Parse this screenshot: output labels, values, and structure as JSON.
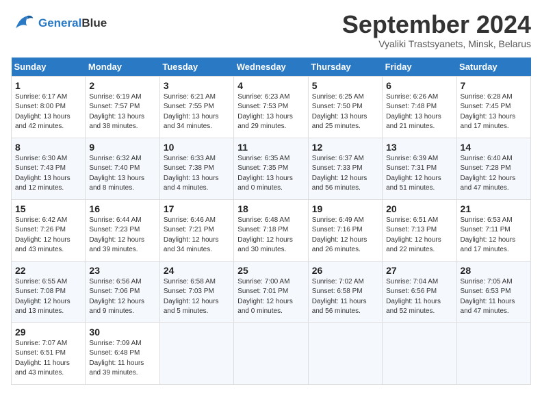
{
  "header": {
    "logo_line1": "General",
    "logo_line2": "Blue",
    "month_title": "September 2024",
    "location": "Vyaliki Trastsyanets, Minsk, Belarus"
  },
  "days_of_week": [
    "Sunday",
    "Monday",
    "Tuesday",
    "Wednesday",
    "Thursday",
    "Friday",
    "Saturday"
  ],
  "weeks": [
    [
      {
        "day": "1",
        "info": "Sunrise: 6:17 AM\nSunset: 8:00 PM\nDaylight: 13 hours\nand 42 minutes."
      },
      {
        "day": "2",
        "info": "Sunrise: 6:19 AM\nSunset: 7:57 PM\nDaylight: 13 hours\nand 38 minutes."
      },
      {
        "day": "3",
        "info": "Sunrise: 6:21 AM\nSunset: 7:55 PM\nDaylight: 13 hours\nand 34 minutes."
      },
      {
        "day": "4",
        "info": "Sunrise: 6:23 AM\nSunset: 7:53 PM\nDaylight: 13 hours\nand 29 minutes."
      },
      {
        "day": "5",
        "info": "Sunrise: 6:25 AM\nSunset: 7:50 PM\nDaylight: 13 hours\nand 25 minutes."
      },
      {
        "day": "6",
        "info": "Sunrise: 6:26 AM\nSunset: 7:48 PM\nDaylight: 13 hours\nand 21 minutes."
      },
      {
        "day": "7",
        "info": "Sunrise: 6:28 AM\nSunset: 7:45 PM\nDaylight: 13 hours\nand 17 minutes."
      }
    ],
    [
      {
        "day": "8",
        "info": "Sunrise: 6:30 AM\nSunset: 7:43 PM\nDaylight: 13 hours\nand 12 minutes."
      },
      {
        "day": "9",
        "info": "Sunrise: 6:32 AM\nSunset: 7:40 PM\nDaylight: 13 hours\nand 8 minutes."
      },
      {
        "day": "10",
        "info": "Sunrise: 6:33 AM\nSunset: 7:38 PM\nDaylight: 13 hours\nand 4 minutes."
      },
      {
        "day": "11",
        "info": "Sunrise: 6:35 AM\nSunset: 7:35 PM\nDaylight: 13 hours\nand 0 minutes."
      },
      {
        "day": "12",
        "info": "Sunrise: 6:37 AM\nSunset: 7:33 PM\nDaylight: 12 hours\nand 56 minutes."
      },
      {
        "day": "13",
        "info": "Sunrise: 6:39 AM\nSunset: 7:31 PM\nDaylight: 12 hours\nand 51 minutes."
      },
      {
        "day": "14",
        "info": "Sunrise: 6:40 AM\nSunset: 7:28 PM\nDaylight: 12 hours\nand 47 minutes."
      }
    ],
    [
      {
        "day": "15",
        "info": "Sunrise: 6:42 AM\nSunset: 7:26 PM\nDaylight: 12 hours\nand 43 minutes."
      },
      {
        "day": "16",
        "info": "Sunrise: 6:44 AM\nSunset: 7:23 PM\nDaylight: 12 hours\nand 39 minutes."
      },
      {
        "day": "17",
        "info": "Sunrise: 6:46 AM\nSunset: 7:21 PM\nDaylight: 12 hours\nand 34 minutes."
      },
      {
        "day": "18",
        "info": "Sunrise: 6:48 AM\nSunset: 7:18 PM\nDaylight: 12 hours\nand 30 minutes."
      },
      {
        "day": "19",
        "info": "Sunrise: 6:49 AM\nSunset: 7:16 PM\nDaylight: 12 hours\nand 26 minutes."
      },
      {
        "day": "20",
        "info": "Sunrise: 6:51 AM\nSunset: 7:13 PM\nDaylight: 12 hours\nand 22 minutes."
      },
      {
        "day": "21",
        "info": "Sunrise: 6:53 AM\nSunset: 7:11 PM\nDaylight: 12 hours\nand 17 minutes."
      }
    ],
    [
      {
        "day": "22",
        "info": "Sunrise: 6:55 AM\nSunset: 7:08 PM\nDaylight: 12 hours\nand 13 minutes."
      },
      {
        "day": "23",
        "info": "Sunrise: 6:56 AM\nSunset: 7:06 PM\nDaylight: 12 hours\nand 9 minutes."
      },
      {
        "day": "24",
        "info": "Sunrise: 6:58 AM\nSunset: 7:03 PM\nDaylight: 12 hours\nand 5 minutes."
      },
      {
        "day": "25",
        "info": "Sunrise: 7:00 AM\nSunset: 7:01 PM\nDaylight: 12 hours\nand 0 minutes."
      },
      {
        "day": "26",
        "info": "Sunrise: 7:02 AM\nSunset: 6:58 PM\nDaylight: 11 hours\nand 56 minutes."
      },
      {
        "day": "27",
        "info": "Sunrise: 7:04 AM\nSunset: 6:56 PM\nDaylight: 11 hours\nand 52 minutes."
      },
      {
        "day": "28",
        "info": "Sunrise: 7:05 AM\nSunset: 6:53 PM\nDaylight: 11 hours\nand 47 minutes."
      }
    ],
    [
      {
        "day": "29",
        "info": "Sunrise: 7:07 AM\nSunset: 6:51 PM\nDaylight: 11 hours\nand 43 minutes."
      },
      {
        "day": "30",
        "info": "Sunrise: 7:09 AM\nSunset: 6:48 PM\nDaylight: 11 hours\nand 39 minutes."
      },
      null,
      null,
      null,
      null,
      null
    ]
  ]
}
